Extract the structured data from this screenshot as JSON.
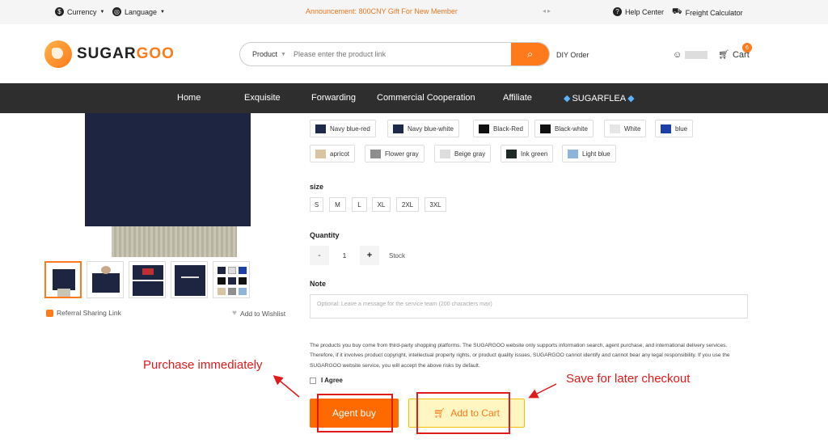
{
  "topbar": {
    "currency": "Currency",
    "language": "Language",
    "announcement_label": "Announcement:",
    "announcement_text": "800CNY Gift For New Member",
    "help": "Help Center",
    "freight": "Freight Calculator"
  },
  "header": {
    "logo_a": "SUGAR",
    "logo_b": "GOO",
    "search_category": "Product",
    "search_placeholder": "Please enter the product link",
    "diy_order": "DIY Order",
    "cart_label": "Cart",
    "cart_count": "6"
  },
  "nav": [
    "Home",
    "Exquisite",
    "Forwarding",
    "Commercial Cooperation",
    "Affiliate",
    "SUGARFLEA"
  ],
  "colors": {
    "row1": [
      {
        "label": "Navy blue-red",
        "swatch": "#1e2a4a"
      },
      {
        "label": "Navy blue-white",
        "swatch": "#1e2a4a"
      },
      {
        "label": "Black-Red",
        "swatch": "#111111"
      },
      {
        "label": "Black-white",
        "swatch": "#111111"
      },
      {
        "label": "White",
        "swatch": "#e6e6e6"
      },
      {
        "label": "blue",
        "swatch": "#1d3fa8"
      }
    ],
    "row2": [
      {
        "label": "apricot",
        "swatch": "#d9c3a0"
      },
      {
        "label": "Flower gray",
        "swatch": "#8e8e8e"
      },
      {
        "label": "Beige gray",
        "swatch": "#dddddd"
      },
      {
        "label": "Ink green",
        "swatch": "#1f2a26"
      },
      {
        "label": "Light blue",
        "swatch": "#8db5db"
      }
    ]
  },
  "size": {
    "label": "size",
    "options": [
      "S",
      "M",
      "L",
      "XL",
      "2XL",
      "3XL"
    ]
  },
  "quantity": {
    "label": "Quantity",
    "minus": "-",
    "value": "1",
    "plus": "+",
    "stock": "Stock"
  },
  "note": {
    "label": "Note",
    "placeholder": "Optional: Leave a message for the service team (200 characters max)"
  },
  "left": {
    "referral": "Referral Sharing Link",
    "wishlist": "Add to Wishlist"
  },
  "disclaimer": "The products you buy come from third-party shopping platforms. The SUGARGOO website only supports information search, agent purchase, and international delivery services. Therefore, if it involves product copyright, intellectual property rights, or product quality issues, SUGARGOO cannot identify and cannot bear any legal responsibility. If you use the SUGARGOO website service, you will accept the above risks by default.",
  "agree": "I Agree",
  "buttons": {
    "agent_buy": "Agent buy",
    "add_to_cart": "Add to Cart"
  },
  "annotations": {
    "left": "Purchase immediately",
    "right": "Save for later checkout",
    "color": "#e01a1a"
  },
  "theme": {
    "accent": "#ff7a1a",
    "nav_bg": "#2e2e2e"
  }
}
